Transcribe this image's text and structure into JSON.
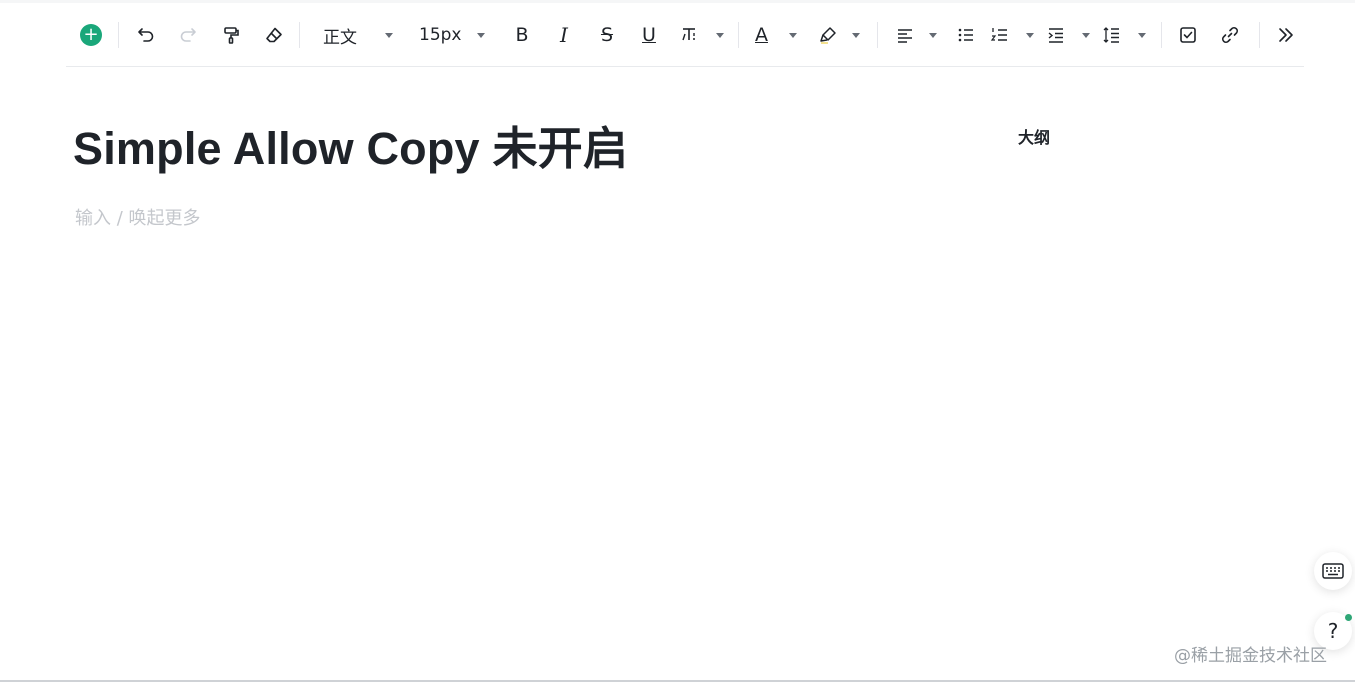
{
  "toolbar": {
    "add_icon": "plus-circle-icon",
    "undo_icon": "undo-icon",
    "redo_icon": "redo-icon",
    "format_painter_icon": "format-painter-icon",
    "clear_format_icon": "eraser-icon",
    "paragraph_style": "正文",
    "font_size": "15px",
    "bold_label": "B",
    "italic_label": "I",
    "strike_label": "S",
    "underline_label": "U",
    "text_effect_icon": "text-effect-icon",
    "font_color_label": "A",
    "highlight_icon": "highlighter-icon",
    "align_icon": "align-left-icon",
    "bullet_list_icon": "bullet-list-icon",
    "ordered_list_icon": "ordered-list-icon",
    "indent_icon": "indent-icon",
    "line_height_icon": "line-height-icon",
    "task_icon": "checkbox-icon",
    "link_icon": "link-icon",
    "more_icon": "double-chevron-right-icon"
  },
  "document": {
    "title": "Simple Allow Copy 未开启",
    "placeholder": "输入 / 唤起更多"
  },
  "outline": {
    "title": "大纲"
  },
  "floating": {
    "keyboard_icon": "keyboard-icon",
    "help_label": "?"
  },
  "watermark": "@稀土掘金技术社区",
  "colors": {
    "accent": "#1aa77a",
    "text": "#1f2329",
    "placeholder": "#c4c7cc",
    "status_dot": "#2ea676"
  }
}
